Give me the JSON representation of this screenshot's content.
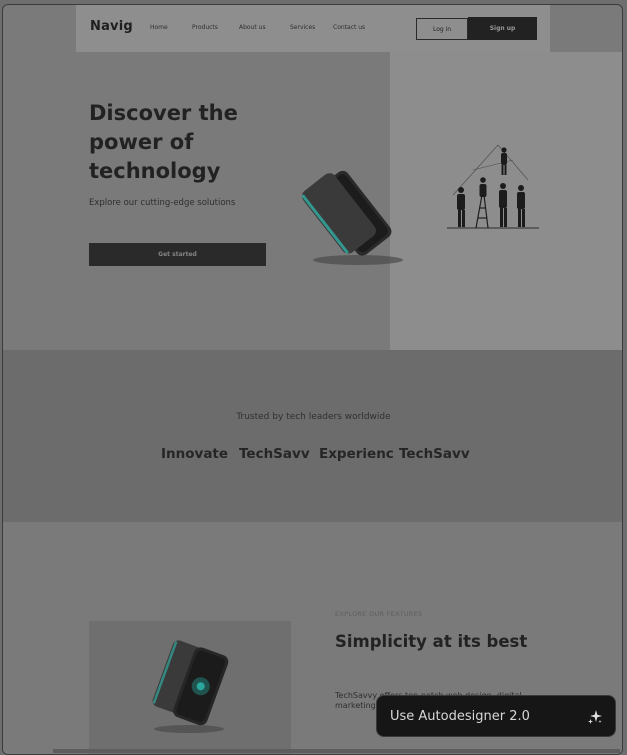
{
  "nav": {
    "brand": "Navig",
    "links": [
      "Home",
      "Products",
      "About us",
      "Services",
      "Contact us"
    ],
    "login_label": "Log in",
    "signup_label": "Sign up"
  },
  "hero": {
    "title": "Discover the power of technology",
    "subtitle": "Explore our cutting-edge solutions",
    "cta_label": "Get started",
    "images": [
      "smartphone-illustration",
      "team-climbing-illustration"
    ]
  },
  "trusted": {
    "label": "Trusted by tech leaders worldwide",
    "logos": [
      "Innovate",
      "TechSavv",
      "Experienc",
      "TechSavv"
    ]
  },
  "features": {
    "kicker": "EXPLORE OUR FEATURES",
    "title": "Simplicity at its best",
    "body": "TechSavvy offers top-notch web design, digital marketing tailored to",
    "image": "smartphone-illustration"
  },
  "floating": {
    "label": "Use Autodesigner 2.0",
    "icon": "sparkle-icon"
  },
  "colors": {
    "dark_button": "#222222",
    "overlay_bg": "#7a7a7a",
    "accent_glow": "#2fd6c8"
  }
}
